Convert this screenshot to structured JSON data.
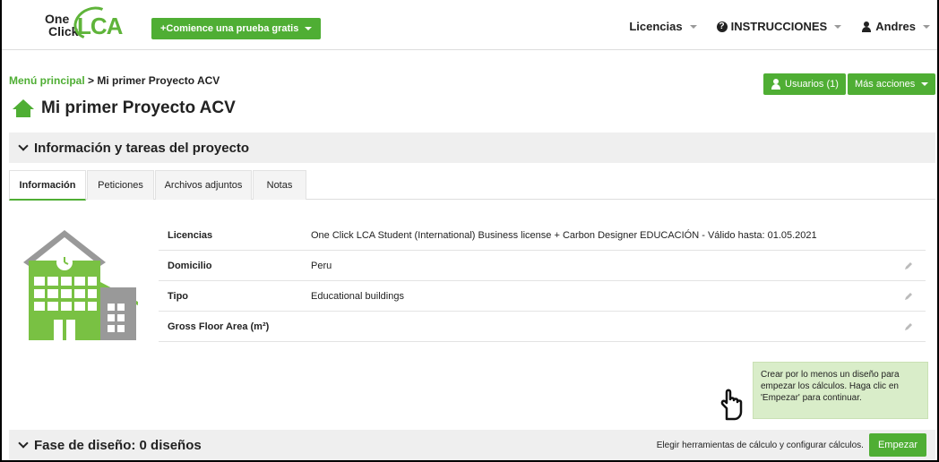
{
  "brand": {
    "logo_top": "One",
    "logo_bottom": "Click",
    "logo_lca": "LCA"
  },
  "header": {
    "trial_button": "+Comience una prueba gratis",
    "nav": {
      "licenses": "Licencias",
      "instructions": "INSTRUCCIONES",
      "user": "Andres"
    }
  },
  "breadcrumb": {
    "home": "Menú principal",
    "separator": " > ",
    "current": "Mi primer Proyecto ACV"
  },
  "page": {
    "title": "Mi primer Proyecto ACV",
    "users_button": "Usuarios (1)",
    "more_actions_button": "Más acciones"
  },
  "info_section": {
    "title": "Información y tareas del proyecto"
  },
  "tabs": [
    {
      "label": "Información",
      "active": true
    },
    {
      "label": "Peticiones",
      "active": false
    },
    {
      "label": "Archivos adjuntos",
      "active": false
    },
    {
      "label": "Notas",
      "active": false
    }
  ],
  "info_rows": [
    {
      "label": "Licencias",
      "value": "One Click LCA Student (International) Business license + Carbon Designer EDUCACIÓN - Válido hasta: 01.05.2021",
      "editable": false
    },
    {
      "label": "Domicilio",
      "value": "Peru",
      "editable": true
    },
    {
      "label": "Tipo",
      "value": "Educational buildings",
      "editable": true
    },
    {
      "label": "Gross Floor Area (m²)",
      "value": "",
      "editable": true
    }
  ],
  "hint": {
    "text": "Crear por lo menos un diseño para empezar los cálculos. Haga clic en 'Empezar' para continuar."
  },
  "design_section": {
    "title": "Fase de diseño: 0 diseños",
    "helper": "Elegir herramientas de cálculo y configurar cálculos.",
    "start_button": "Empezar"
  },
  "colors": {
    "accent": "#4fae34",
    "hint_bg": "#d9edc9",
    "section_bg": "#efefef"
  }
}
